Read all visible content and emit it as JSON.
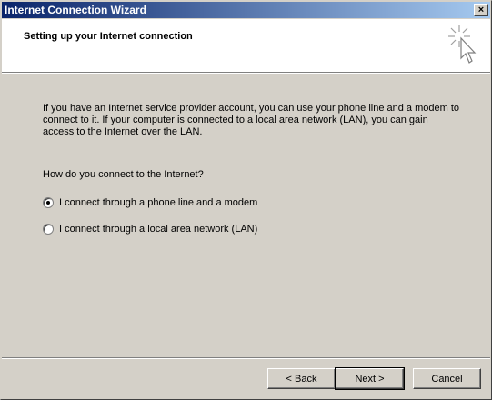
{
  "window": {
    "title": "Internet Connection Wizard",
    "close_label": "×"
  },
  "header": {
    "title": "Setting up your Internet connection",
    "icon": "wizard-cursor-sparkle-icon"
  },
  "content": {
    "intro": "If you have an Internet service provider account, you can use your phone line and a modem to connect to it. If your computer is connected to a local area network (LAN), you can gain access to the Internet over the LAN.",
    "question": "How do you connect to the Internet?",
    "options": [
      {
        "label": "I connect through a phone line and a modem",
        "selected": true
      },
      {
        "label": "I connect through a local area network (LAN)",
        "selected": false
      }
    ]
  },
  "buttons": {
    "back": "< Back",
    "next": "Next >",
    "cancel": "Cancel"
  }
}
